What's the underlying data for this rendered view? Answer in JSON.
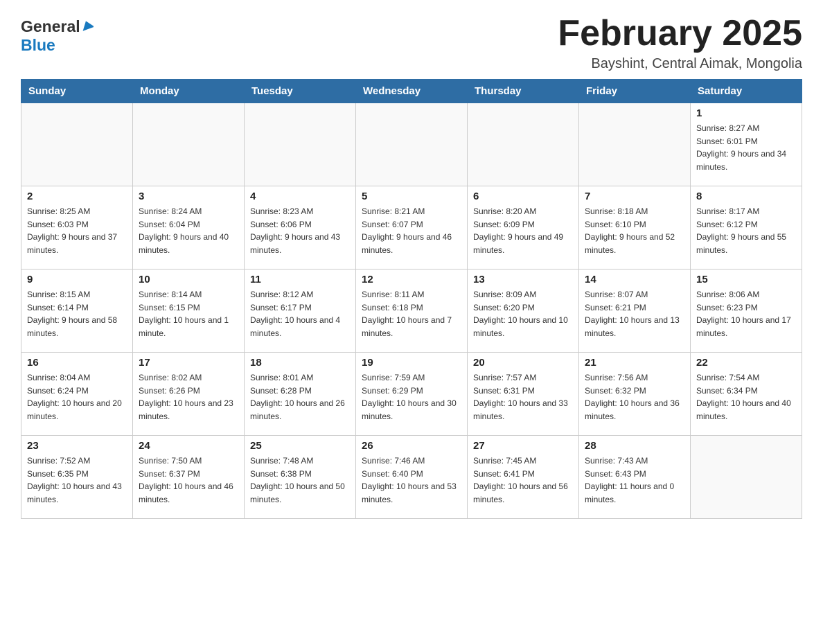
{
  "header": {
    "logo": {
      "general": "General",
      "blue": "Blue"
    },
    "title": "February 2025",
    "location": "Bayshint, Central Aimak, Mongolia"
  },
  "days_of_week": [
    "Sunday",
    "Monday",
    "Tuesday",
    "Wednesday",
    "Thursday",
    "Friday",
    "Saturday"
  ],
  "weeks": [
    [
      {
        "day": "",
        "sunrise": "",
        "sunset": "",
        "daylight": ""
      },
      {
        "day": "",
        "sunrise": "",
        "sunset": "",
        "daylight": ""
      },
      {
        "day": "",
        "sunrise": "",
        "sunset": "",
        "daylight": ""
      },
      {
        "day": "",
        "sunrise": "",
        "sunset": "",
        "daylight": ""
      },
      {
        "day": "",
        "sunrise": "",
        "sunset": "",
        "daylight": ""
      },
      {
        "day": "",
        "sunrise": "",
        "sunset": "",
        "daylight": ""
      },
      {
        "day": "1",
        "sunrise": "Sunrise: 8:27 AM",
        "sunset": "Sunset: 6:01 PM",
        "daylight": "Daylight: 9 hours and 34 minutes."
      }
    ],
    [
      {
        "day": "2",
        "sunrise": "Sunrise: 8:25 AM",
        "sunset": "Sunset: 6:03 PM",
        "daylight": "Daylight: 9 hours and 37 minutes."
      },
      {
        "day": "3",
        "sunrise": "Sunrise: 8:24 AM",
        "sunset": "Sunset: 6:04 PM",
        "daylight": "Daylight: 9 hours and 40 minutes."
      },
      {
        "day": "4",
        "sunrise": "Sunrise: 8:23 AM",
        "sunset": "Sunset: 6:06 PM",
        "daylight": "Daylight: 9 hours and 43 minutes."
      },
      {
        "day": "5",
        "sunrise": "Sunrise: 8:21 AM",
        "sunset": "Sunset: 6:07 PM",
        "daylight": "Daylight: 9 hours and 46 minutes."
      },
      {
        "day": "6",
        "sunrise": "Sunrise: 8:20 AM",
        "sunset": "Sunset: 6:09 PM",
        "daylight": "Daylight: 9 hours and 49 minutes."
      },
      {
        "day": "7",
        "sunrise": "Sunrise: 8:18 AM",
        "sunset": "Sunset: 6:10 PM",
        "daylight": "Daylight: 9 hours and 52 minutes."
      },
      {
        "day": "8",
        "sunrise": "Sunrise: 8:17 AM",
        "sunset": "Sunset: 6:12 PM",
        "daylight": "Daylight: 9 hours and 55 minutes."
      }
    ],
    [
      {
        "day": "9",
        "sunrise": "Sunrise: 8:15 AM",
        "sunset": "Sunset: 6:14 PM",
        "daylight": "Daylight: 9 hours and 58 minutes."
      },
      {
        "day": "10",
        "sunrise": "Sunrise: 8:14 AM",
        "sunset": "Sunset: 6:15 PM",
        "daylight": "Daylight: 10 hours and 1 minute."
      },
      {
        "day": "11",
        "sunrise": "Sunrise: 8:12 AM",
        "sunset": "Sunset: 6:17 PM",
        "daylight": "Daylight: 10 hours and 4 minutes."
      },
      {
        "day": "12",
        "sunrise": "Sunrise: 8:11 AM",
        "sunset": "Sunset: 6:18 PM",
        "daylight": "Daylight: 10 hours and 7 minutes."
      },
      {
        "day": "13",
        "sunrise": "Sunrise: 8:09 AM",
        "sunset": "Sunset: 6:20 PM",
        "daylight": "Daylight: 10 hours and 10 minutes."
      },
      {
        "day": "14",
        "sunrise": "Sunrise: 8:07 AM",
        "sunset": "Sunset: 6:21 PM",
        "daylight": "Daylight: 10 hours and 13 minutes."
      },
      {
        "day": "15",
        "sunrise": "Sunrise: 8:06 AM",
        "sunset": "Sunset: 6:23 PM",
        "daylight": "Daylight: 10 hours and 17 minutes."
      }
    ],
    [
      {
        "day": "16",
        "sunrise": "Sunrise: 8:04 AM",
        "sunset": "Sunset: 6:24 PM",
        "daylight": "Daylight: 10 hours and 20 minutes."
      },
      {
        "day": "17",
        "sunrise": "Sunrise: 8:02 AM",
        "sunset": "Sunset: 6:26 PM",
        "daylight": "Daylight: 10 hours and 23 minutes."
      },
      {
        "day": "18",
        "sunrise": "Sunrise: 8:01 AM",
        "sunset": "Sunset: 6:28 PM",
        "daylight": "Daylight: 10 hours and 26 minutes."
      },
      {
        "day": "19",
        "sunrise": "Sunrise: 7:59 AM",
        "sunset": "Sunset: 6:29 PM",
        "daylight": "Daylight: 10 hours and 30 minutes."
      },
      {
        "day": "20",
        "sunrise": "Sunrise: 7:57 AM",
        "sunset": "Sunset: 6:31 PM",
        "daylight": "Daylight: 10 hours and 33 minutes."
      },
      {
        "day": "21",
        "sunrise": "Sunrise: 7:56 AM",
        "sunset": "Sunset: 6:32 PM",
        "daylight": "Daylight: 10 hours and 36 minutes."
      },
      {
        "day": "22",
        "sunrise": "Sunrise: 7:54 AM",
        "sunset": "Sunset: 6:34 PM",
        "daylight": "Daylight: 10 hours and 40 minutes."
      }
    ],
    [
      {
        "day": "23",
        "sunrise": "Sunrise: 7:52 AM",
        "sunset": "Sunset: 6:35 PM",
        "daylight": "Daylight: 10 hours and 43 minutes."
      },
      {
        "day": "24",
        "sunrise": "Sunrise: 7:50 AM",
        "sunset": "Sunset: 6:37 PM",
        "daylight": "Daylight: 10 hours and 46 minutes."
      },
      {
        "day": "25",
        "sunrise": "Sunrise: 7:48 AM",
        "sunset": "Sunset: 6:38 PM",
        "daylight": "Daylight: 10 hours and 50 minutes."
      },
      {
        "day": "26",
        "sunrise": "Sunrise: 7:46 AM",
        "sunset": "Sunset: 6:40 PM",
        "daylight": "Daylight: 10 hours and 53 minutes."
      },
      {
        "day": "27",
        "sunrise": "Sunrise: 7:45 AM",
        "sunset": "Sunset: 6:41 PM",
        "daylight": "Daylight: 10 hours and 56 minutes."
      },
      {
        "day": "28",
        "sunrise": "Sunrise: 7:43 AM",
        "sunset": "Sunset: 6:43 PM",
        "daylight": "Daylight: 11 hours and 0 minutes."
      },
      {
        "day": "",
        "sunrise": "",
        "sunset": "",
        "daylight": ""
      }
    ]
  ]
}
